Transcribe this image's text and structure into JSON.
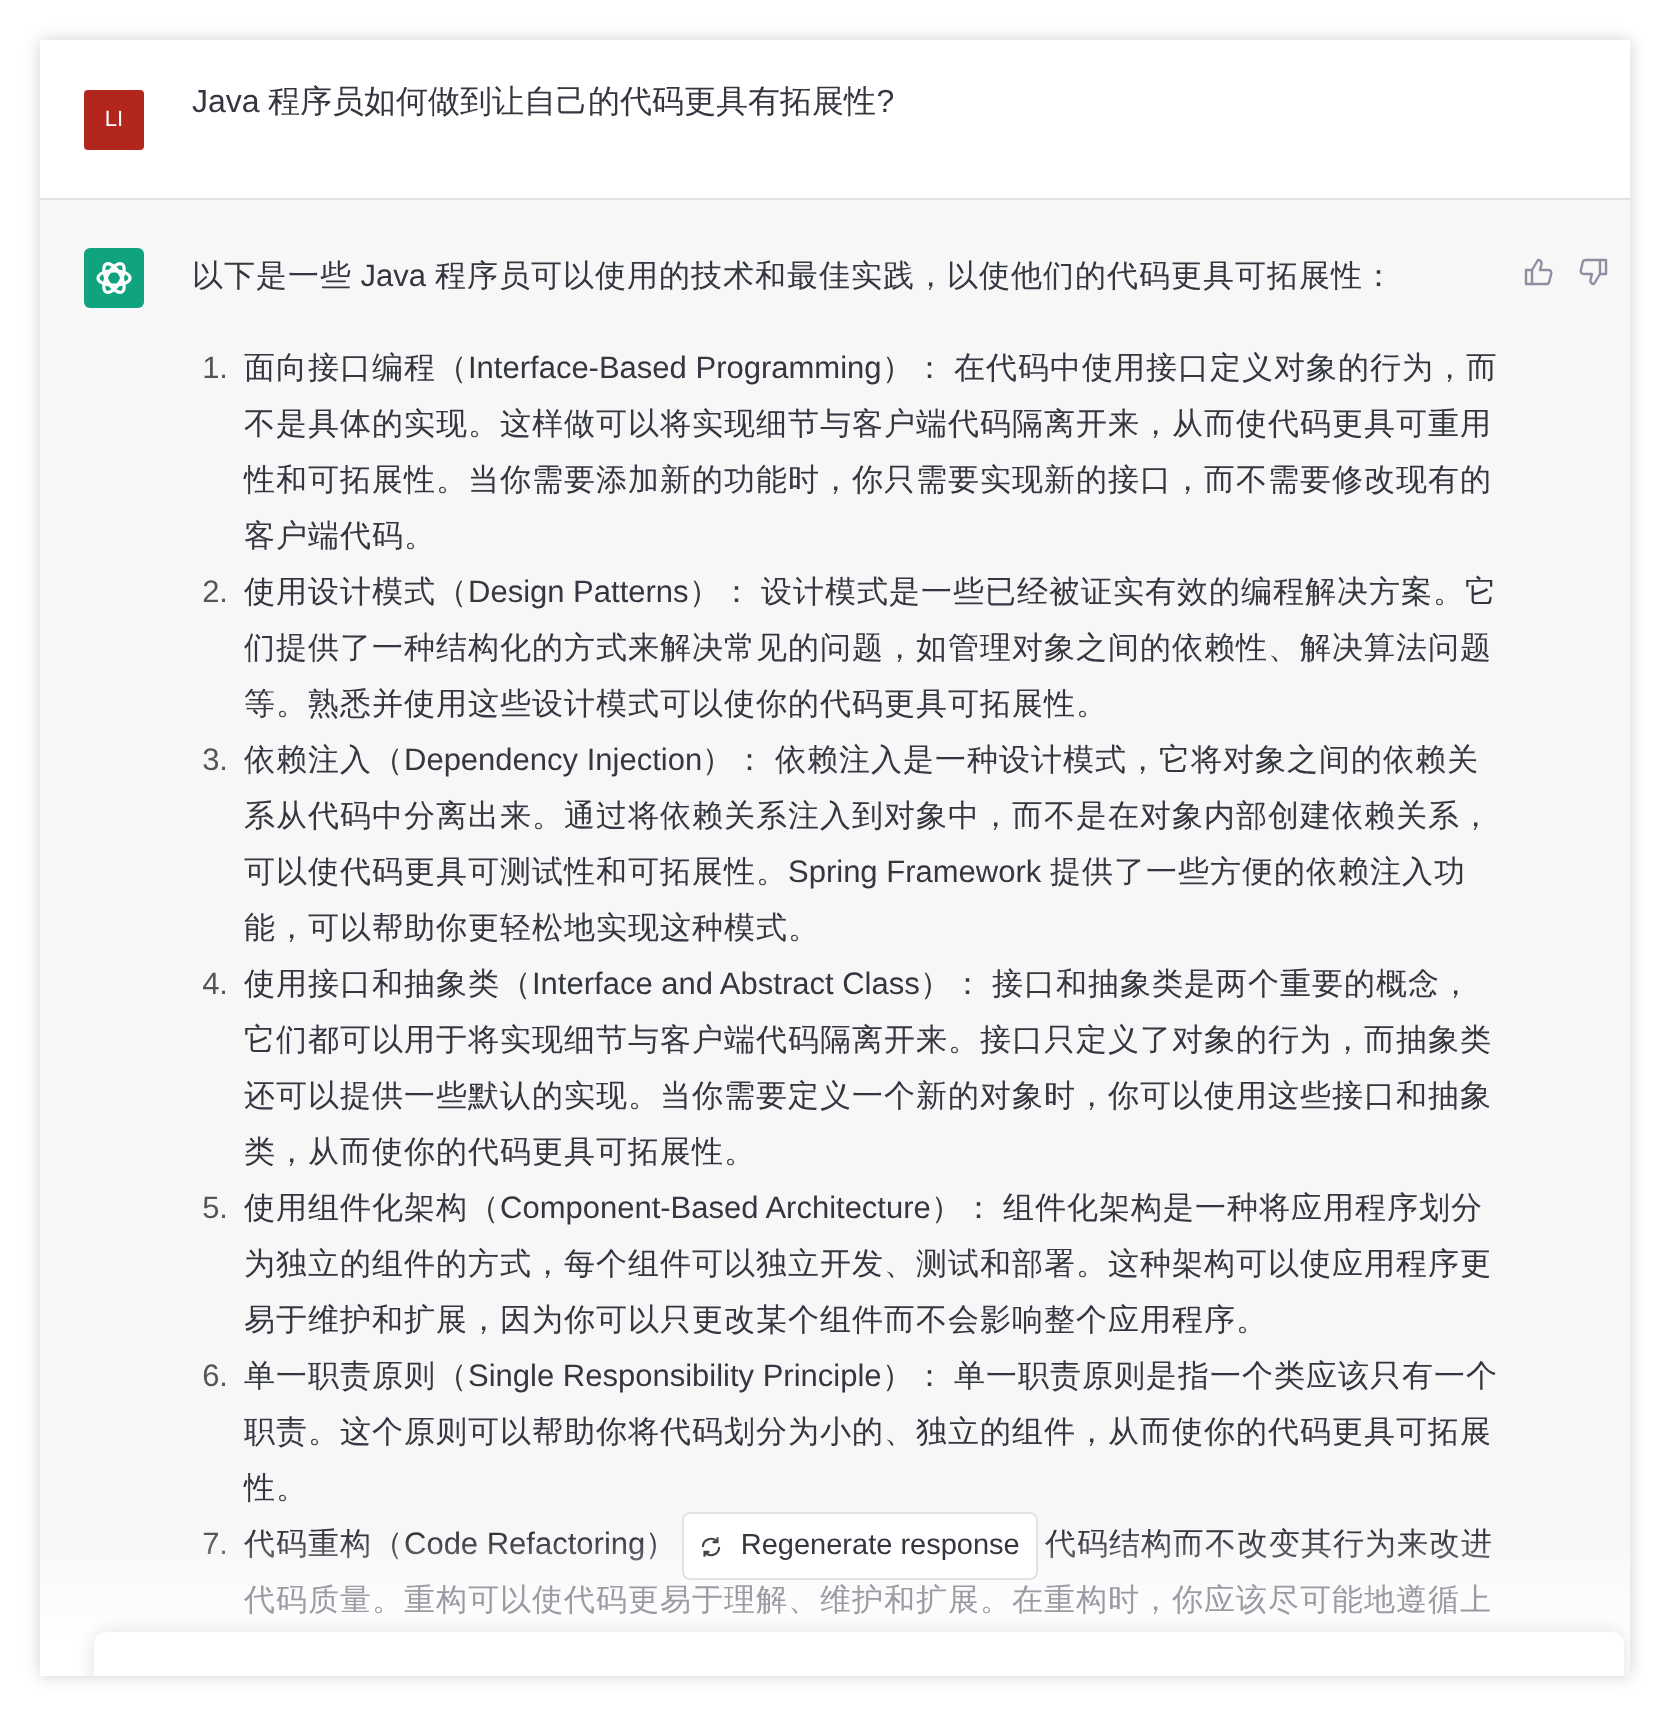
{
  "question": {
    "avatar": "LI",
    "text": "Java 程序员如何做到让自己的代码更具有拓展性?"
  },
  "answer": {
    "intro": "以下是一些 Java 程序员可以使用的技术和最佳实践，以使他们的代码更具可拓展性：",
    "items": [
      {
        "number": "1.",
        "text": "面向接口编程（Interface-Based Programming）： 在代码中使用接口定义对象的行为，而不是具体的实现。这样做可以将实现细节与客户端代码隔离开来，从而使代码更具可重用性和可拓展性。当你需要添加新的功能时，你只需要实现新的接口，而不需要修改现有的客户端代码。"
      },
      {
        "number": "2.",
        "text": "使用设计模式（Design Patterns）： 设计模式是一些已经被证实有效的编程解决方案。它们提供了一种结构化的方式来解决常见的问题，如管理对象之间的依赖性、解决算法问题等。熟悉并使用这些设计模式可以使你的代码更具可拓展性。"
      },
      {
        "number": "3.",
        "text": "依赖注入（Dependency Injection）： 依赖注入是一种设计模式，它将对象之间的依赖关系从代码中分离出来。通过将依赖关系注入到对象中，而不是在对象内部创建依赖关系，可以使代码更具可测试性和可拓展性。Spring Framework 提供了一些方便的依赖注入功能，可以帮助你更轻松地实现这种模式。"
      },
      {
        "number": "4.",
        "text": "使用接口和抽象类（Interface and Abstract Class）： 接口和抽象类是两个重要的概念，它们都可以用于将实现细节与客户端代码隔离开来。接口只定义了对象的行为，而抽象类还可以提供一些默认的实现。当你需要定义一个新的对象时，你可以使用这些接口和抽象类，从而使你的代码更具可拓展性。"
      },
      {
        "number": "5.",
        "text": "使用组件化架构（Component-Based Architecture）： 组件化架构是一种将应用程序划分为独立的组件的方式，每个组件可以独立开发、测试和部署。这种架构可以使应用程序更易于维护和扩展，因为你可以只更改某个组件而不会影响整个应用程序。"
      },
      {
        "number": "6.",
        "text": "单一职责原则（Single Responsibility Principle）： 单一职责原则是指一个类应该只有一个职责。这个原则可以帮助你将代码划分为小的、独立的组件，从而使你的代码更具可拓展性。"
      }
    ],
    "partial_item": {
      "number": "7.",
      "text_left": "代码重构（Code Refactoring）",
      "text_right": "代码结构而不改变其行为来改进",
      "text_line_2": "代码质量。重构可以使代码更易于理解、维护和扩展。在重构时，你应该尽可能地遵循上"
    }
  },
  "regenerate_button": {
    "label": "Regenerate response"
  }
}
